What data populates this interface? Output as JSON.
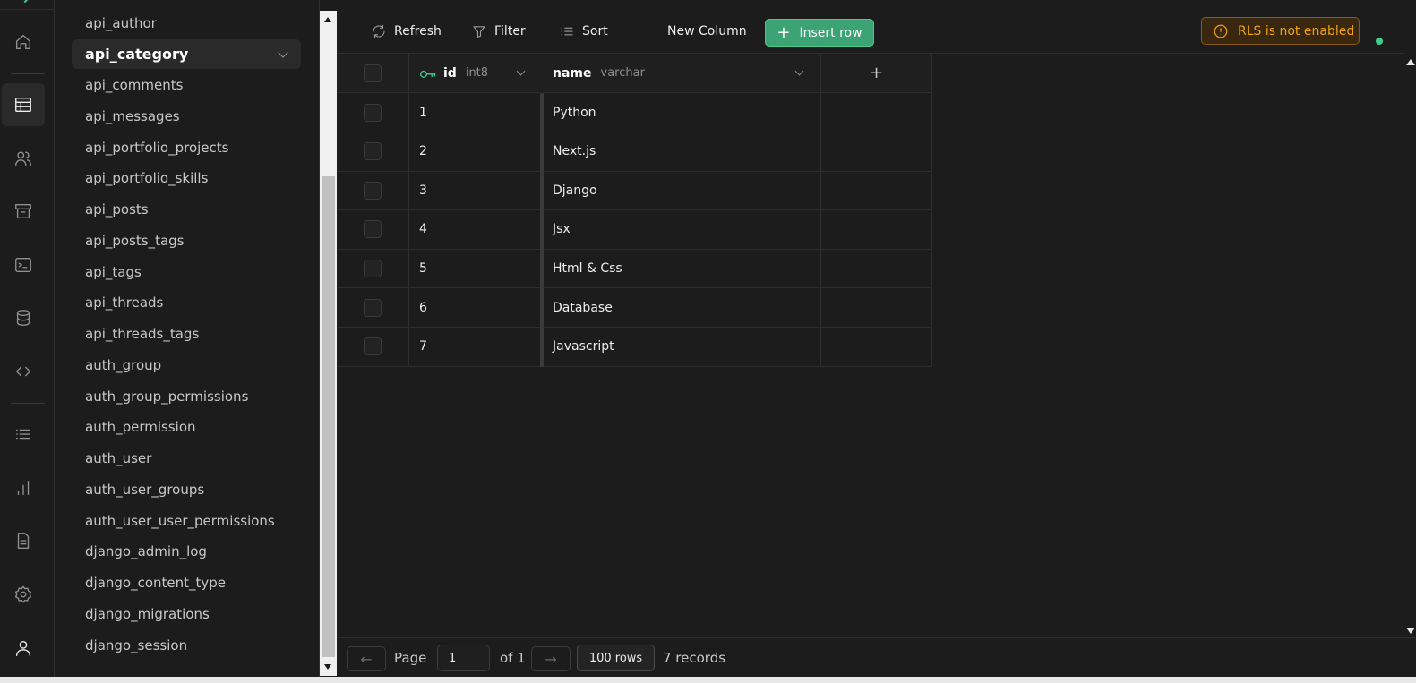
{
  "sidebar": {
    "tables": [
      "api_author",
      "api_category",
      "api_comments",
      "api_messages",
      "api_portfolio_projects",
      "api_portfolio_skills",
      "api_posts",
      "api_posts_tags",
      "api_tags",
      "api_threads",
      "api_threads_tags",
      "auth_group",
      "auth_group_permissions",
      "auth_permission",
      "auth_user",
      "auth_user_groups",
      "auth_user_user_permissions",
      "django_admin_log",
      "django_content_type",
      "django_migrations",
      "django_session"
    ],
    "active_table": "api_category"
  },
  "rail": {
    "icons": [
      "home-icon",
      "table-editor-icon",
      "users-icon",
      "storage-icon",
      "terminal-icon",
      "database-icon",
      "code-icon",
      "list-icon",
      "chart-icon",
      "document-icon",
      "settings-icon",
      "user-icon"
    ],
    "active": "table-editor-icon"
  },
  "toolbar": {
    "refresh_label": "Refresh",
    "filter_label": "Filter",
    "sort_label": "Sort",
    "new_column_label": "New Column",
    "insert_row_label": "Insert row",
    "rls_warning": "RLS is not enabled"
  },
  "grid": {
    "columns": [
      {
        "name": "id",
        "type": "int8",
        "primary_key": true
      },
      {
        "name": "name",
        "type": "varchar"
      }
    ],
    "add_column_symbol": "+",
    "rows": [
      {
        "id": "1",
        "name": "Python"
      },
      {
        "id": "2",
        "name": "Next.js"
      },
      {
        "id": "3",
        "name": "Django"
      },
      {
        "id": "4",
        "name": "Jsx"
      },
      {
        "id": "5",
        "name": "Html & Css"
      },
      {
        "id": "6",
        "name": "Database"
      },
      {
        "id": "7",
        "name": "Javascript"
      }
    ]
  },
  "footer": {
    "page_label": "Page",
    "page_value": "1",
    "of_label": "of 1",
    "rows_per_page": "100 rows",
    "records": "7 records",
    "prev_symbol": "←",
    "next_symbol": "→"
  },
  "colors": {
    "accent": "#3ecf8e",
    "insert_button": "#3ba374",
    "warning": "#f1a10d",
    "background": "#1c1c1c"
  }
}
